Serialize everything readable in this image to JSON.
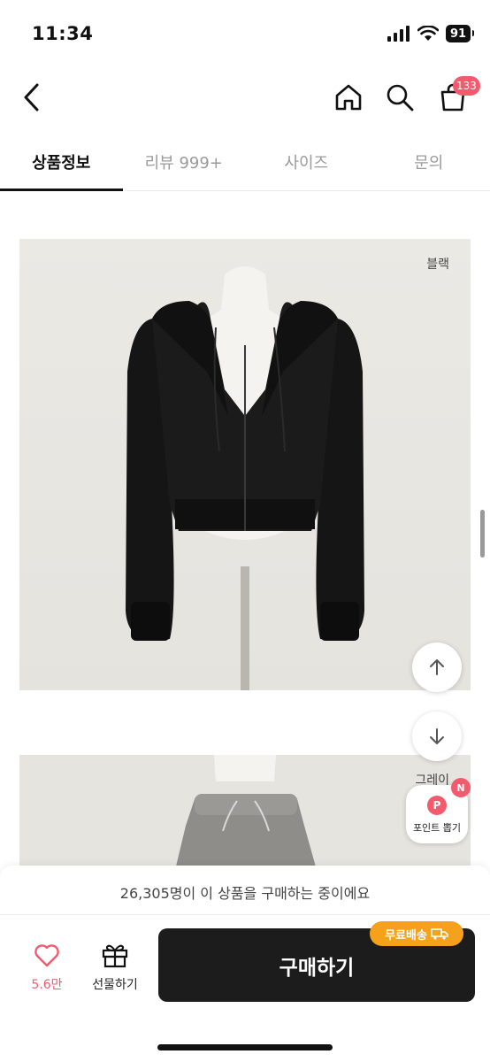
{
  "status_bar": {
    "time": "11:34",
    "battery": "91"
  },
  "header": {
    "cart_count": "133"
  },
  "tabs": [
    {
      "label": "상품정보",
      "active": true
    },
    {
      "label": "리뷰 999+",
      "active": false
    },
    {
      "label": "사이즈",
      "active": false
    },
    {
      "label": "문의",
      "active": false
    }
  ],
  "images": [
    {
      "color_label": "블랙"
    },
    {
      "color_label": "그레이"
    }
  ],
  "point_button": {
    "label": "포인트 뽑기",
    "badge": "N",
    "icon_letter": "P"
  },
  "bottom": {
    "buyer_notice": "26,305명이 이 상품을 구매하는 중이에요",
    "like_count": "5.6만",
    "gift_label": "선물하기",
    "buy_label": "구매하기",
    "free_shipping_label": "무료배송"
  },
  "colors": {
    "accent": "#f25b6d",
    "shipping": "#f5a11c",
    "buy_button": "#1c1c1c"
  }
}
